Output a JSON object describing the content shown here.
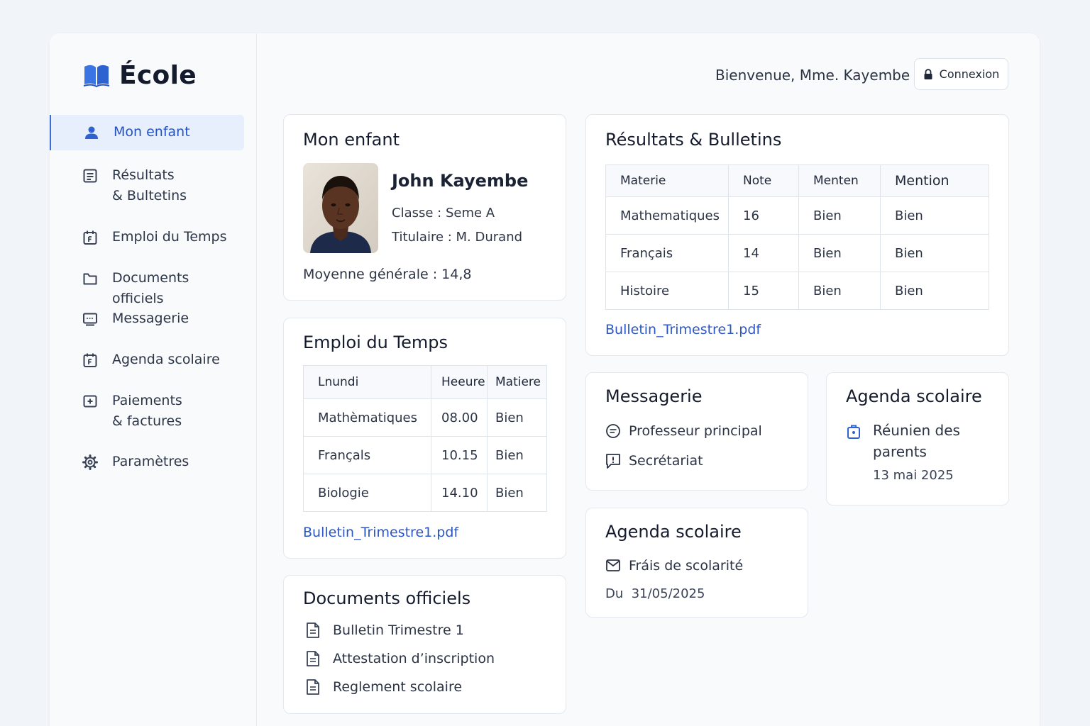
{
  "brand": {
    "title": "École",
    "icon": "open-book-icon"
  },
  "sidebar": {
    "items": [
      {
        "label": "Mon enfant",
        "icon": "user-icon",
        "active": true
      },
      {
        "label": "Résultats\n& Bultetins",
        "icon": "list-icon"
      },
      {
        "label": "Emploi du Temps",
        "icon": "calendar-icon"
      },
      {
        "label": "Documents officiels",
        "icon": "folder-icon"
      },
      {
        "label": "Messagerie",
        "icon": "message-icon"
      },
      {
        "label": "Agenda scolaire",
        "icon": "calendar-icon"
      },
      {
        "label": "Paiements\n& factures",
        "icon": "payment-icon"
      },
      {
        "label": "Paramètres",
        "icon": "gear-icon"
      }
    ]
  },
  "header": {
    "greeting": "Bienvenue, Mme. Kayembe",
    "login_label": "Connexion"
  },
  "child": {
    "title": "Mon enfant",
    "name": "John Kayembe",
    "classe": "Classe : Seme A",
    "titulaire": "Titulaire : M. Durand",
    "average": "Moyenne générale : 14,8"
  },
  "results": {
    "title": "Résultats & Bulletins",
    "headers": [
      "Materie",
      "Note",
      "Menten",
      "Mention"
    ],
    "rows": [
      [
        "Mathematiques",
        "16",
        "Bien",
        "Bien"
      ],
      [
        "Français",
        "14",
        "Bien",
        "Bien"
      ],
      [
        "Histoire",
        "15",
        "Bien",
        "Bien"
      ]
    ],
    "link": "Bulletin_Trimestre1.pdf"
  },
  "timetable": {
    "title": "Emploi du Temps",
    "headers": [
      "Lnundi",
      "Heeure",
      "Matiere"
    ],
    "rows": [
      [
        "Mathèmatiques",
        "08.00",
        "Bien"
      ],
      [
        "Françals",
        "10.15",
        "Bien"
      ],
      [
        "Biologie",
        "14.10",
        "Bien"
      ]
    ],
    "link": "Bulletin_Trimestre1.pdf"
  },
  "messaging": {
    "title": "Messagerie",
    "items": [
      "Professeur principal",
      "Secrétariat"
    ]
  },
  "agenda": {
    "title": "Agenda scolaire",
    "event": "Réunien des\nparents",
    "date": "13 mai 2025"
  },
  "agenda2": {
    "title": "Agenda scolaire",
    "event": "Fráis de scolarité",
    "date": "Du  31/05/2025"
  },
  "documents": {
    "title": "Documents officiels",
    "items": [
      "Bulletin Trimestre 1",
      "Attestation d’inscription",
      "Reglement scolaire"
    ]
  },
  "colors": {
    "accent": "#2553c4",
    "link": "#2a56c6",
    "active_bg": "#e7effc"
  }
}
